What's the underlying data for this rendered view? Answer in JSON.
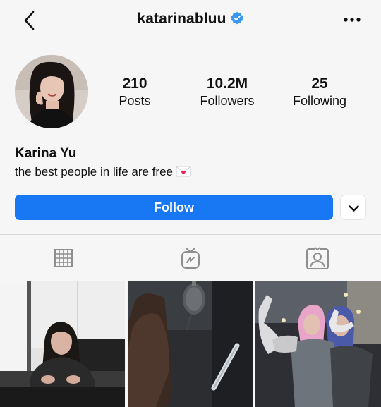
{
  "header": {
    "username": "katarinabluu",
    "verified": true,
    "back_icon": "chevron-left-icon",
    "more_icon": "more-horizontal-icon"
  },
  "profile": {
    "stats": {
      "posts_count": "210",
      "posts_label": "Posts",
      "followers_count": "10.2M",
      "followers_label": "Followers",
      "following_count": "25",
      "following_label": "Following"
    },
    "display_name": "Karina Yu",
    "bio": "the best people in life are free",
    "bio_emoji": "love-letter-icon"
  },
  "actions": {
    "follow_label": "Follow",
    "suggest_icon": "chevron-down-icon"
  },
  "tabs": [
    {
      "icon": "grid-icon",
      "active": true
    },
    {
      "icon": "igtv-icon",
      "active": false
    },
    {
      "icon": "tagged-icon",
      "active": false
    }
  ],
  "colors": {
    "accent": "#1877f2",
    "verified": "#3897f0",
    "background": "#f6f6f7",
    "divider": "#d9d9db",
    "icon_gray": "#8e8e8e"
  }
}
